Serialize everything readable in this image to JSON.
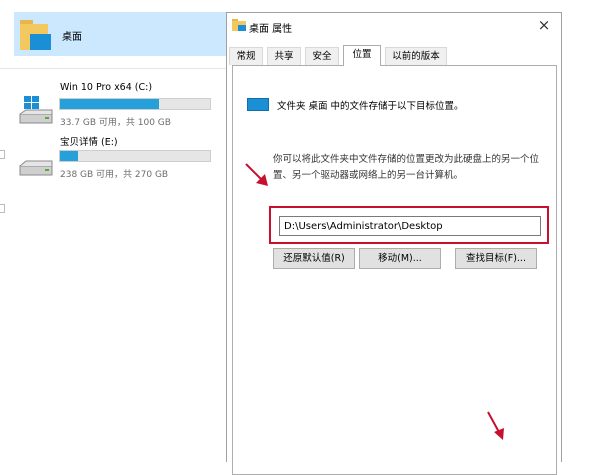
{
  "explorer": {
    "quick_access": {
      "label": "桌面"
    },
    "drives": [
      {
        "name": "Win 10 Pro x64 (C:)",
        "capacity": "33.7 GB 可用，共 100 GB",
        "used_fraction": 0.66
      },
      {
        "name": "宝贝详情 (E:)",
        "capacity": "238 GB 可用，共 270 GB",
        "used_fraction": 0.12
      }
    ]
  },
  "dialog": {
    "title": "桌面 属性",
    "close_label": "×",
    "tabs": [
      {
        "label": "常规"
      },
      {
        "label": "共享"
      },
      {
        "label": "安全"
      },
      {
        "label": "位置",
        "active": true
      },
      {
        "label": "以前的版本"
      }
    ],
    "location": {
      "heading": "文件夹 桌面 中的文件存储于以下目标位置。",
      "description": "你可以将此文件夹中文件存储的位置更改为此硬盘上的另一个位置、另一个驱动器或网络上的另一台计算机。",
      "path_value": "D:\\Users\\Administrator\\Desktop",
      "buttons": {
        "restore": "还原默认值(R)",
        "move": "移动(M)...",
        "find": "查找目标(F)..."
      }
    }
  },
  "colors": {
    "selection": "#cce8ff",
    "progress": "#26a0da",
    "annotation": "#c8102e"
  }
}
